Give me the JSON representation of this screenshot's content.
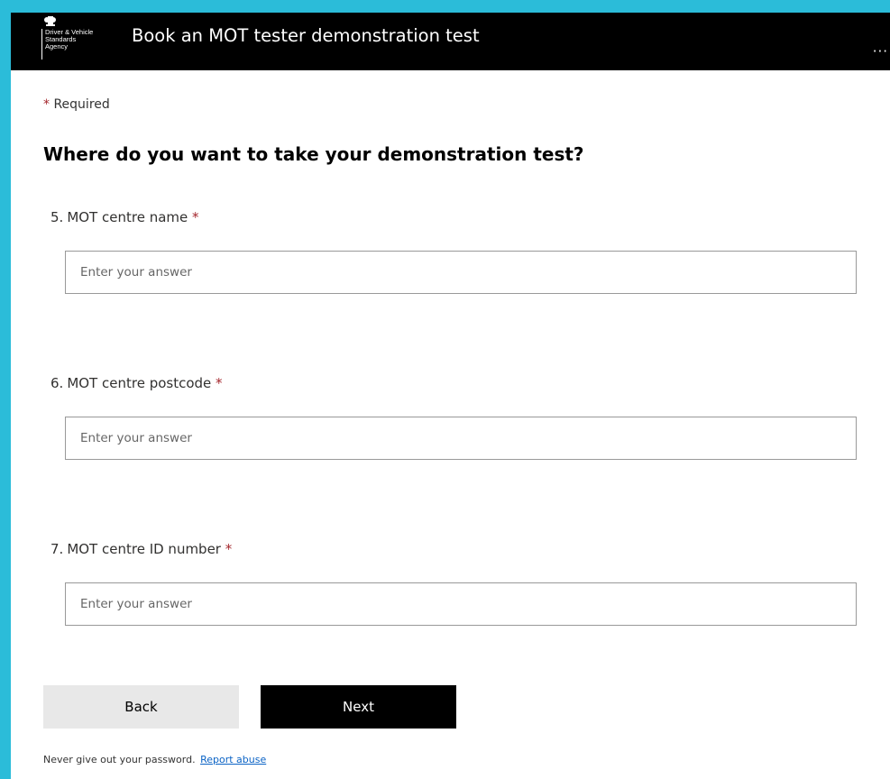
{
  "header": {
    "logo_lines": "Driver & Vehicle\nStandards\nAgency",
    "title": "Book an MOT tester demonstration test",
    "more_icon": "more-options-icon"
  },
  "required_note": {
    "asterisk": "*",
    "text": "Required"
  },
  "section_title": "Where do you want to take your demonstration test?",
  "questions": [
    {
      "number": "5.",
      "label": "MOT centre name",
      "required_mark": "*",
      "placeholder": "Enter your answer",
      "value": ""
    },
    {
      "number": "6.",
      "label": "MOT centre postcode",
      "required_mark": "*",
      "placeholder": "Enter your answer",
      "value": ""
    },
    {
      "number": "7.",
      "label": "MOT centre ID number",
      "required_mark": "*",
      "placeholder": "Enter your answer",
      "value": ""
    }
  ],
  "buttons": {
    "back": "Back",
    "next": "Next"
  },
  "footer": {
    "text": "Never give out your password.",
    "link": "Report abuse"
  },
  "colors": {
    "page_background": "#2bbcd9",
    "header_background": "#000000",
    "required_asterisk": "#a4262c",
    "link": "#0b63c5",
    "back_button": "#e8e8e8",
    "next_button": "#000000"
  }
}
